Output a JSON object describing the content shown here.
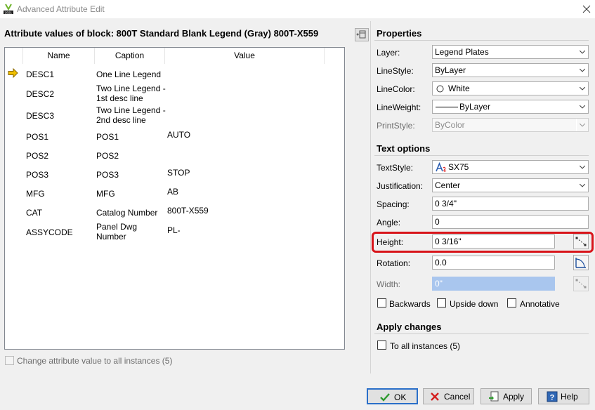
{
  "window": {
    "title": "Advanced Attribute Edit",
    "app_icon": "autocad-electrical-2021-icon",
    "close_icon": "close-icon"
  },
  "left": {
    "block_label": "Attribute values of block: 800T Standard Blank Legend (Gray) 800T-X559",
    "columns": {
      "name": "Name",
      "caption": "Caption",
      "value": "Value"
    },
    "rows": [
      {
        "name": "DESC1",
        "caption": "One Line Legend",
        "value": "",
        "current": true
      },
      {
        "name": "DESC2",
        "caption": "Two Line Legend - 1st desc line",
        "value": ""
      },
      {
        "name": "DESC3",
        "caption": "Two Line Legend - 2nd desc line",
        "value": ""
      },
      {
        "name": "POS1",
        "caption": "POS1",
        "value": "AUTO"
      },
      {
        "name": "POS2",
        "caption": "POS2",
        "value": ""
      },
      {
        "name": "POS3",
        "caption": "POS3",
        "value": "STOP"
      },
      {
        "name": "MFG",
        "caption": "MFG",
        "value": "AB"
      },
      {
        "name": "CAT",
        "caption": "Catalog Number",
        "value": "800T-X559"
      },
      {
        "name": "ASSYCODE",
        "caption": "Panel Dwg Number",
        "value": "PL-"
      }
    ],
    "change_all_label": "Change attribute value to all instances (5)"
  },
  "properties": {
    "title": "Properties",
    "layer": {
      "label": "Layer:",
      "value": "Legend Plates"
    },
    "linestyle": {
      "label": "LineStyle:",
      "value": "ByLayer"
    },
    "linecolor": {
      "label": "LineColor:",
      "value": "White"
    },
    "lineweight": {
      "label": "LineWeight:",
      "value": "ByLayer"
    },
    "printstyle": {
      "label": "PrintStyle:",
      "value": "ByColor"
    }
  },
  "text_options": {
    "title": "Text options",
    "textstyle": {
      "label": "TextStyle:",
      "value": "SX75"
    },
    "justification": {
      "label": "Justification:",
      "value": "Center"
    },
    "spacing": {
      "label": "Spacing:",
      "value": "0 3/4\""
    },
    "angle": {
      "label": "Angle:",
      "value": "0"
    },
    "height": {
      "label": "Height:",
      "value": "0 3/16\""
    },
    "rotation": {
      "label": "Rotation:",
      "value": "0.0"
    },
    "width": {
      "label": "Width:",
      "value": "0\""
    },
    "backwards": "Backwards",
    "upside_down": "Upside down",
    "annotative": "Annotative"
  },
  "apply_changes": {
    "title": "Apply changes",
    "to_all_instances": "To all instances (5)"
  },
  "buttons": {
    "ok": "OK",
    "cancel": "Cancel",
    "apply": "Apply",
    "help": "Help"
  },
  "colors": {
    "highlight": "#d8141a",
    "default_button_border": "#2a6fc9",
    "disabled_field": "#a9c6ee"
  }
}
